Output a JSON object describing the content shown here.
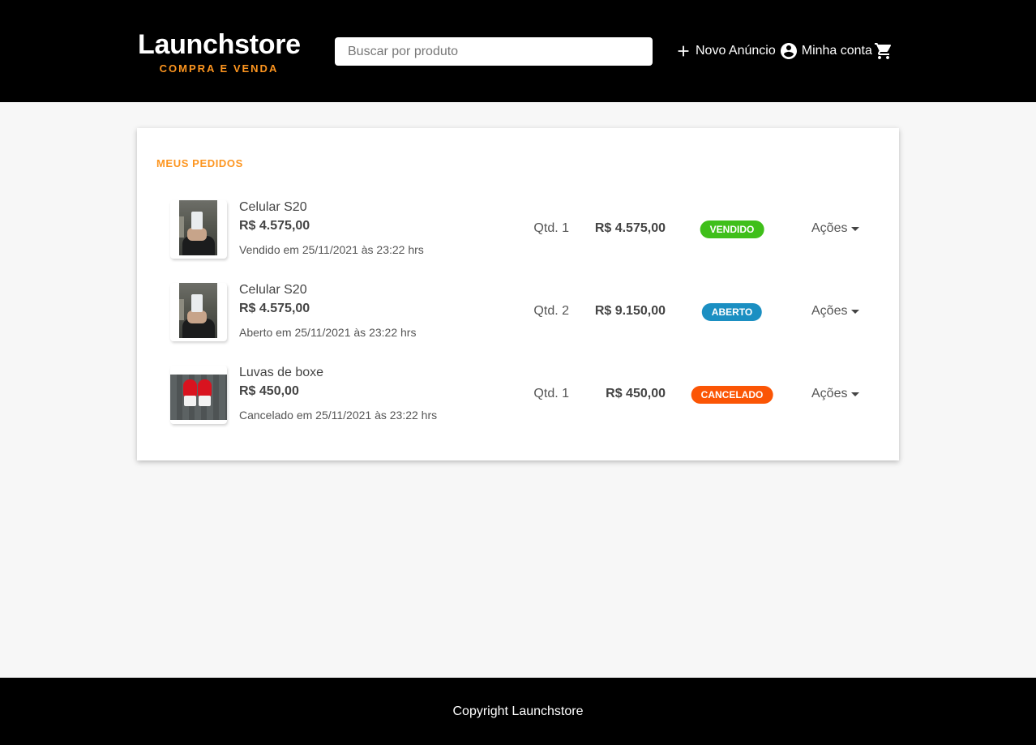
{
  "header": {
    "logo_title": "Launchstore",
    "logo_subtitle": "COMPRA E VENDA",
    "search_placeholder": "Buscar por produto",
    "nav": {
      "new_ad": "Novo Anúncio",
      "account": "Minha conta"
    }
  },
  "main": {
    "section_title": "MEUS PEDIDOS",
    "orders": [
      {
        "image": "phone-photo",
        "name": "Celular S20",
        "price": "R$ 4.575,00",
        "status_text": "Vendido em 25/11/2021 às 23:22 hrs",
        "quantity": "Qtd. 1",
        "total": "R$ 4.575,00",
        "badge": "VENDIDO",
        "badge_color": "#3fbf1a",
        "actions": "Ações"
      },
      {
        "image": "phone-photo",
        "name": "Celular S20",
        "price": "R$ 4.575,00",
        "status_text": "Aberto em 25/11/2021 às 23:22 hrs",
        "quantity": "Qtd. 2",
        "total": "R$ 9.150,00",
        "badge": "ABERTO",
        "badge_color": "#1b8fc2",
        "actions": "Ações"
      },
      {
        "image": "boxing-gloves-photo",
        "name": "Luvas de boxe",
        "price": "R$ 450,00",
        "status_text": "Cancelado em 25/11/2021 às 23:22 hrs",
        "quantity": "Qtd. 1",
        "total": "R$ 450,00",
        "badge": "CANCELADO",
        "badge_color": "#fb5505",
        "actions": "Ações"
      }
    ]
  },
  "footer": {
    "copyright": "Copyright Launchstore"
  },
  "colors": {
    "accent": "#fd951f",
    "header_bg": "#000000",
    "page_bg": "#f7f7f7"
  },
  "icons": [
    "plus-icon",
    "account-circle-icon",
    "cart-icon",
    "caret-down-icon"
  ]
}
